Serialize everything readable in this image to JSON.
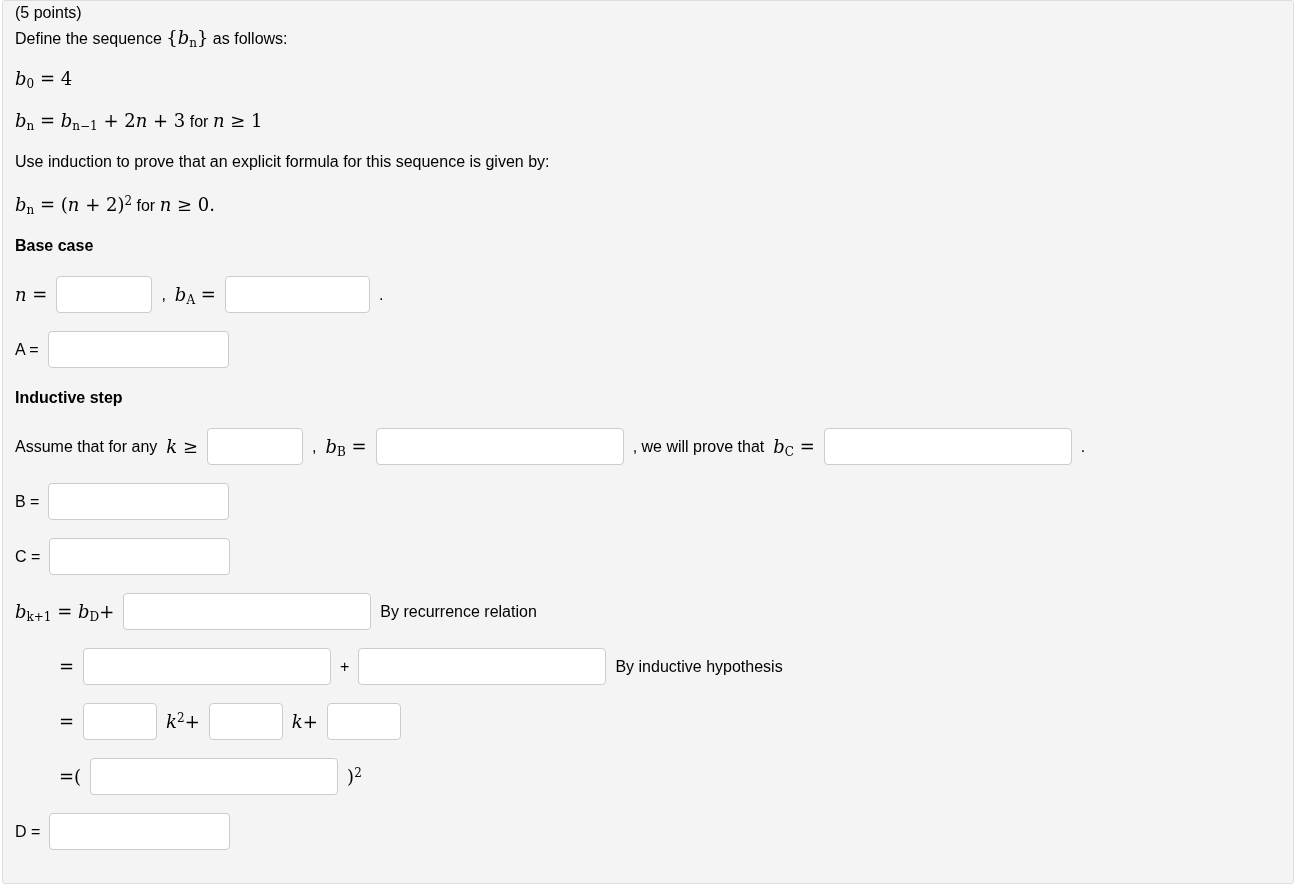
{
  "points": "(5 points)",
  "lines": [
    {
      "kind": "text",
      "segments": [
        {
          "kind": "text",
          "text": "Define the sequence "
        },
        {
          "kind": "math",
          "text": "{*b*$_{n}$}"
        },
        {
          "kind": "text",
          "text": " as follows:"
        }
      ]
    },
    {
      "kind": "text",
      "segments": [
        {
          "kind": "math",
          "text": "*b*$_{0}$ = 4"
        }
      ]
    },
    {
      "kind": "text",
      "segments": [
        {
          "kind": "math",
          "text": "*b*$_{n}$ = *b*$_{n−1}$ + 2"
        },
        {
          "kind": "math",
          "text": "*n* + 3"
        },
        {
          "kind": "text",
          "text": " for "
        },
        {
          "kind": "math",
          "text": "*n* ≥ 1"
        }
      ]
    },
    {
      "kind": "text",
      "segments": [
        {
          "kind": "text",
          "text": "Use induction to prove that an explicit formula for this sequence is given by:"
        }
      ]
    },
    {
      "kind": "text",
      "segments": [
        {
          "kind": "math",
          "text": "*b*$_{n}$ = (*n* + 2)$^{2}$"
        },
        {
          "kind": "text",
          "text": " for "
        },
        {
          "kind": "math",
          "text": "*n* ≥ 0."
        }
      ]
    },
    {
      "kind": "heading",
      "segments": [
        {
          "kind": "text",
          "text": "Base case"
        }
      ]
    },
    {
      "kind": "row",
      "segments": [
        {
          "kind": "math",
          "text": "*n* ="
        },
        {
          "kind": "field"
        },
        {
          "kind": "text",
          "text": ","
        },
        {
          "kind": "math",
          "text": "*b*$_{A}$ ="
        },
        {
          "kind": "field"
        },
        {
          "kind": "text",
          "text": "."
        }
      ]
    },
    {
      "kind": "row",
      "segments": [
        {
          "kind": "text",
          "text": "A ="
        },
        {
          "kind": "field"
        }
      ]
    },
    {
      "kind": "heading",
      "segments": [
        {
          "kind": "text",
          "text": "Inductive step"
        }
      ]
    },
    {
      "kind": "row",
      "segments": [
        {
          "kind": "text",
          "text": "Assume that for any"
        },
        {
          "kind": "math",
          "text": "*k* ≥"
        },
        {
          "kind": "field"
        },
        {
          "kind": "text",
          "text": ","
        },
        {
          "kind": "math",
          "text": "*b*$_{B}$ ="
        },
        {
          "kind": "field"
        },
        {
          "kind": "text",
          "text": ", we will prove that"
        },
        {
          "kind": "math",
          "text": "*b*$_{C}$ ="
        },
        {
          "kind": "field"
        },
        {
          "kind": "text",
          "text": "."
        }
      ]
    },
    {
      "kind": "row",
      "segments": [
        {
          "kind": "text",
          "text": "B ="
        },
        {
          "kind": "field"
        }
      ]
    },
    {
      "kind": "row",
      "segments": [
        {
          "kind": "text",
          "text": "C ="
        },
        {
          "kind": "field"
        }
      ]
    },
    {
      "kind": "row",
      "segments": [
        {
          "kind": "math",
          "text": "*b*$_{k+1}$ = *b*$_{D}$+"
        },
        {
          "kind": "field"
        },
        {
          "kind": "text",
          "text": "By recurrence relation"
        }
      ]
    },
    {
      "kind": "continuation",
      "segments": [
        {
          "kind": "math",
          "text": "="
        },
        {
          "kind": "field"
        },
        {
          "kind": "text",
          "text": "+"
        },
        {
          "kind": "field"
        },
        {
          "kind": "text",
          "text": "By inductive hypothesis"
        }
      ]
    },
    {
      "kind": "continuation",
      "segments": [
        {
          "kind": "math",
          "text": "="
        },
        {
          "kind": "field"
        },
        {
          "kind": "math",
          "text": "*k*$^{2}$+"
        },
        {
          "kind": "field"
        },
        {
          "kind": "math",
          "text": "*k*+"
        },
        {
          "kind": "field"
        }
      ]
    },
    {
      "kind": "continuation",
      "segments": [
        {
          "kind": "math",
          "text": "=("
        },
        {
          "kind": "field"
        },
        {
          "kind": "math",
          "text": ")$^{2}$"
        }
      ]
    },
    {
      "kind": "row",
      "segments": [
        {
          "kind": "text",
          "text": "D ="
        },
        {
          "kind": "field"
        }
      ]
    }
  ]
}
